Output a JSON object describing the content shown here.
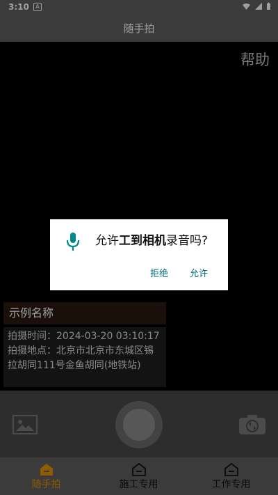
{
  "status": {
    "time": "3:10",
    "notification_letter": "A",
    "wifi_icon": "wifi-icon",
    "signal_icon": "cell-signal-icon",
    "battery_icon": "battery-icon"
  },
  "header": {
    "title": "随手拍"
  },
  "camera": {
    "help_label": "帮助",
    "info": {
      "title": "示例名称",
      "time_line": "拍摄时间：2024-03-20 03:10:17",
      "location_line": "拍摄地点：北京市北京市东城区锡拉胡同111号金鱼胡同(地铁站)"
    }
  },
  "controls": {
    "gallery_icon": "image-icon",
    "shutter_icon": "shutter-button",
    "switch_camera_icon": "camera-switch-icon"
  },
  "nav": {
    "items": [
      {
        "label": "随手拍",
        "icon": "home-icon"
      },
      {
        "label": "施工专用",
        "icon": "home-icon"
      },
      {
        "label": "工作专用",
        "icon": "home-icon"
      }
    ]
  },
  "dialog": {
    "title_prefix": "允许",
    "title_app": "工到相机",
    "title_suffix": "录音吗?",
    "deny_label": "拒绝",
    "allow_label": "允许",
    "icon": "microphone-icon"
  },
  "colors": {
    "accent": "#e59300",
    "dialog_button": "#006b7a",
    "mic": "#008b8b"
  }
}
